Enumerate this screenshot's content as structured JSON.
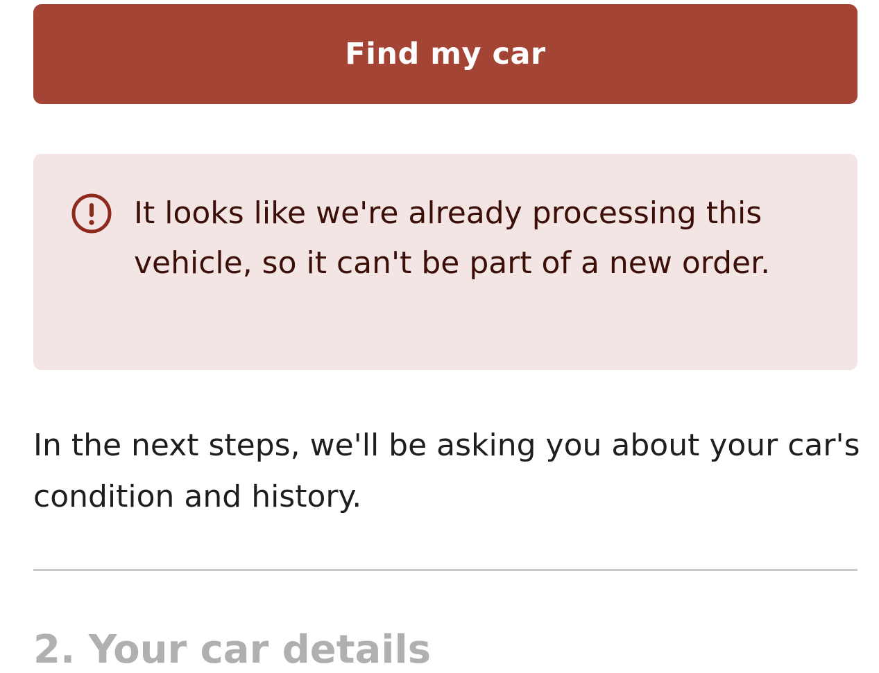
{
  "find_button": {
    "label": "Find my car"
  },
  "alert": {
    "icon": "exclamation-circle-icon",
    "message": "It looks like we're already processing this vehicle, so it can't be part of a new order."
  },
  "intro_text": "In the next steps, we'll be asking you about your car's condition and history.",
  "next_section": {
    "title": "2. Your car details"
  },
  "colors": {
    "button_bg": "#a34435",
    "alert_bg": "#f2e5e3",
    "alert_text": "#3b0f08",
    "alert_icon": "#8e2a1c",
    "section_title": "#b0b0b0"
  }
}
